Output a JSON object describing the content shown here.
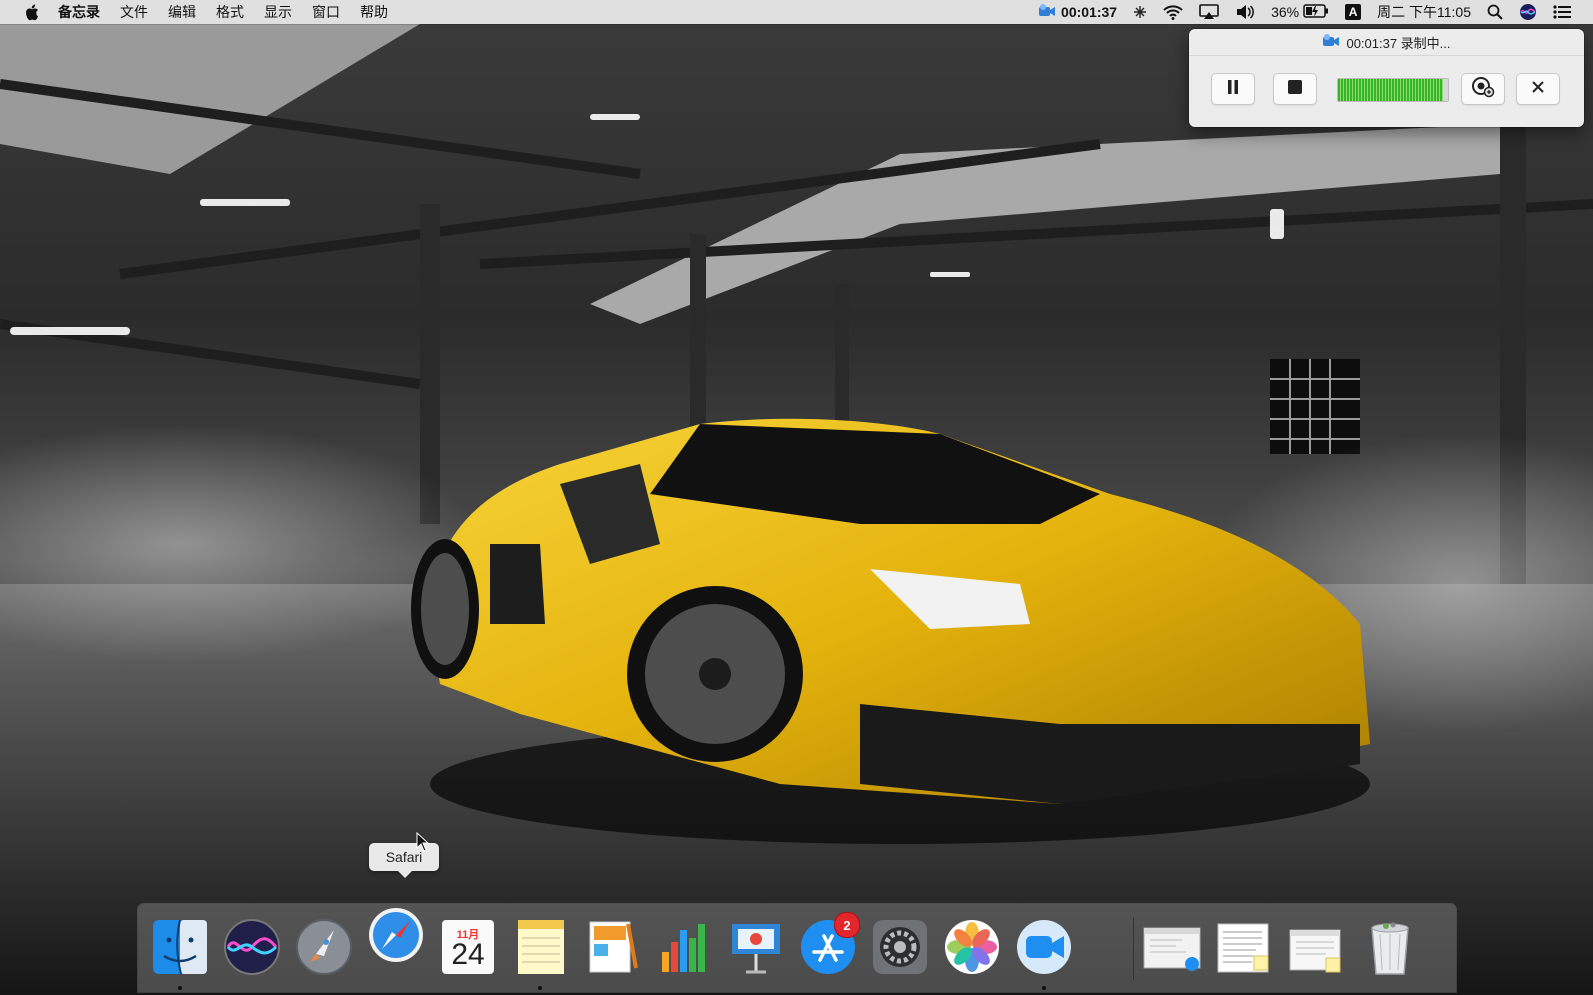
{
  "menubar": {
    "app_name": "备忘录",
    "menus": [
      "文件",
      "编辑",
      "格式",
      "显示",
      "窗口",
      "帮助"
    ],
    "recording_time": "00:01:37",
    "battery_percent": "36%",
    "input_method": "A",
    "clock": "周二 下午11:05"
  },
  "recorder": {
    "title": "00:01:37 录制中...",
    "audio_level": 0.95
  },
  "tooltip": {
    "label": "Safari"
  },
  "dock": {
    "calendar": {
      "month": "11月",
      "day": "24"
    },
    "app_store_badge": "2",
    "items": [
      {
        "icon": "finder-icon",
        "running": true
      },
      {
        "icon": "siri-icon",
        "running": false
      },
      {
        "icon": "launchpad-icon",
        "running": false
      },
      {
        "icon": "safari-icon",
        "running": false
      },
      {
        "icon": "calendar-icon",
        "running": false
      },
      {
        "icon": "notes-icon",
        "running": true
      },
      {
        "icon": "pages-icon",
        "running": false
      },
      {
        "icon": "numbers-icon",
        "running": false
      },
      {
        "icon": "keynote-icon",
        "running": false
      },
      {
        "icon": "app-store-icon",
        "running": false
      },
      {
        "icon": "system-preferences-icon",
        "running": false
      },
      {
        "icon": "photos-icon",
        "running": false
      },
      {
        "icon": "facetime-recorder-icon",
        "running": true
      }
    ]
  }
}
